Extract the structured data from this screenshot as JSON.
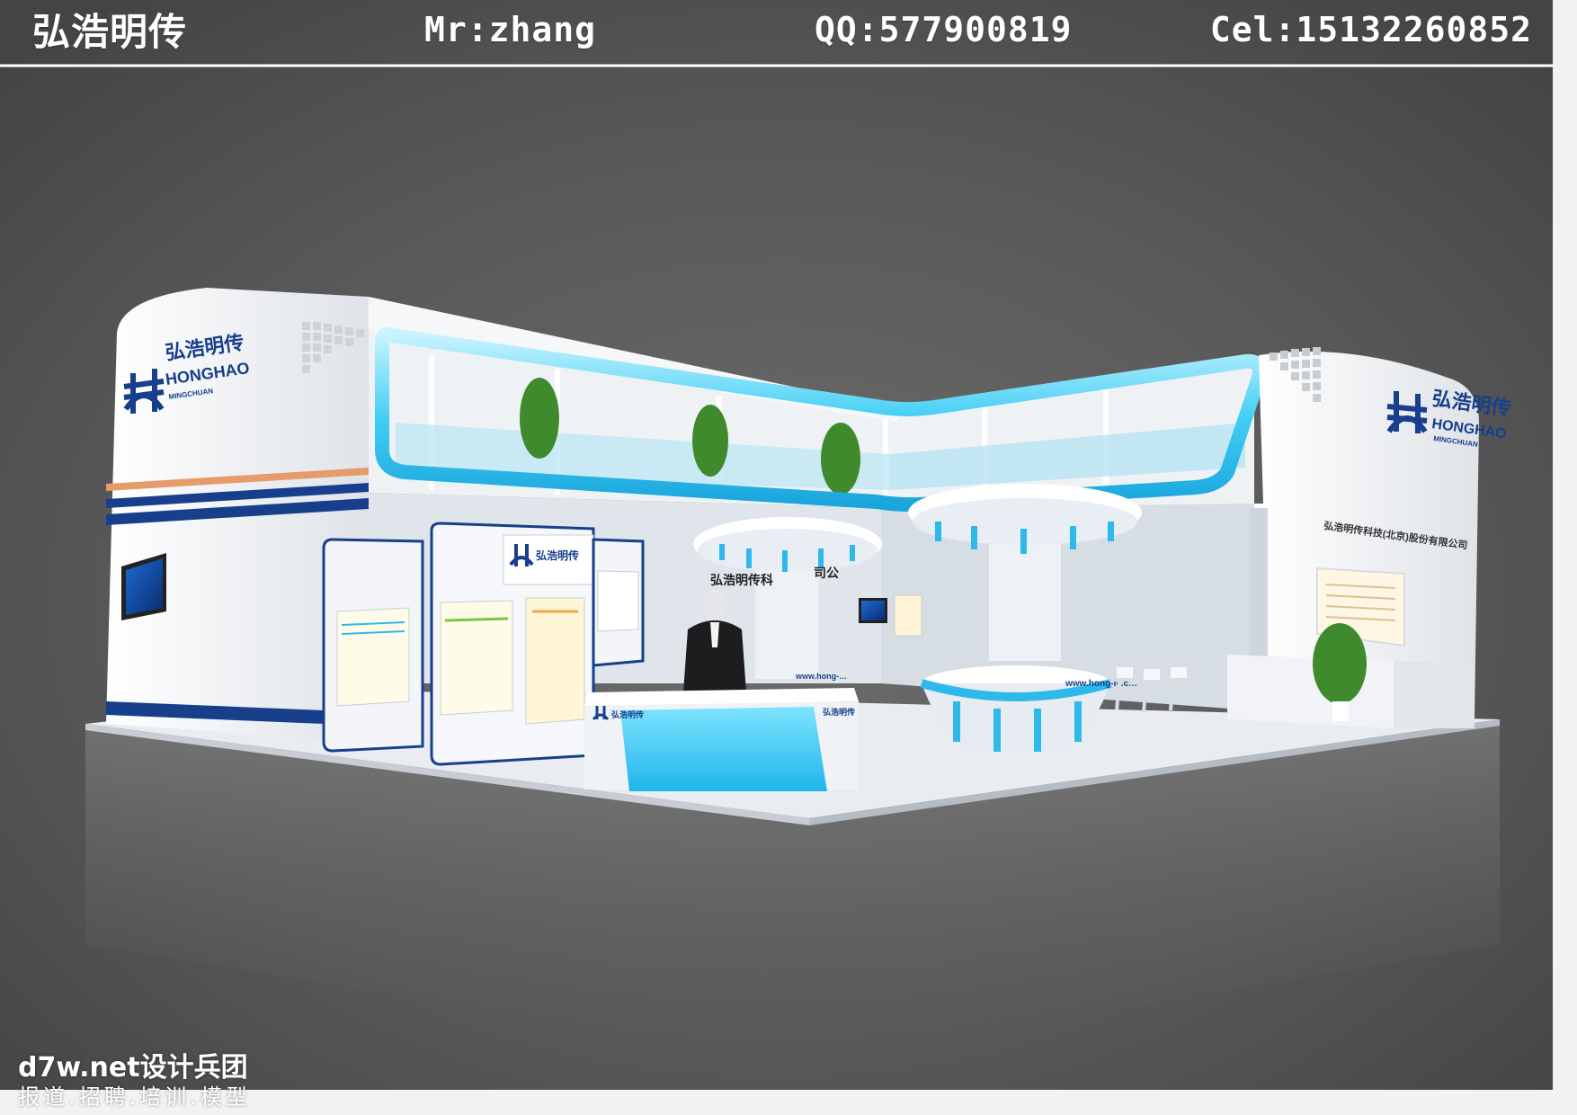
{
  "header": {
    "brand": "弘浩明传",
    "contact_name": "Mr:zhang",
    "contact_qq": "QQ:577900819",
    "contact_phone": "Cel:15132260852"
  },
  "booth": {
    "logo_cn": "弘浩明传",
    "logo_en": "HONGHAO",
    "logo_sub": "MINGCHUAN",
    "fascia_partial_left": "弘浩明传科",
    "fascia_partial_right": "司公",
    "fascia_full": "弘浩明传科技(北京)股份有限公司",
    "counter_url_1": "www.hong-…",
    "counter_url_2": "www.hong-le.c…"
  },
  "watermark": {
    "line1": "d7w.net设计兵团",
    "line2": "报道.招聘.培训.模型"
  },
  "colors": {
    "background": "#5c5c5c",
    "accent_blue": "#2fb9ea",
    "brand_navy": "#173f8c",
    "frame": "#f2f2f2"
  }
}
